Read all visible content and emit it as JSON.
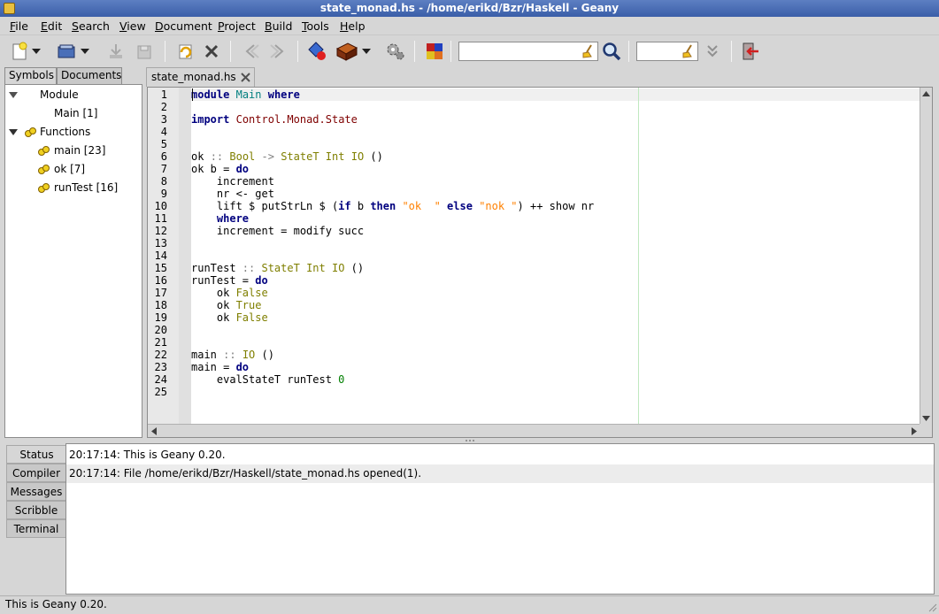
{
  "window": {
    "title": "state_monad.hs - /home/erikd/Bzr/Haskell - Geany"
  },
  "menu": [
    {
      "label": "File",
      "u": "F",
      "rest": "ile"
    },
    {
      "label": "Edit",
      "u": "E",
      "rest": "dit"
    },
    {
      "label": "Search",
      "u": "S",
      "rest": "earch"
    },
    {
      "label": "View",
      "u": "V",
      "rest": "iew"
    },
    {
      "label": "Document",
      "u": "D",
      "rest": "ocument"
    },
    {
      "label": "Project",
      "u": "P",
      "rest": "roject"
    },
    {
      "label": "Build",
      "u": "B",
      "rest": "uild"
    },
    {
      "label": "Tools",
      "u": "T",
      "rest": "ools"
    },
    {
      "label": "Help",
      "u": "H",
      "rest": "elp"
    }
  ],
  "toolbar": {
    "search_value": "",
    "goto_value": ""
  },
  "sidebar": {
    "tabs": [
      "Symbols",
      "Documents"
    ],
    "active_tab": "Symbols",
    "tree": {
      "module_group": "Module",
      "module_item": "Main [1]",
      "functions_group": "Functions",
      "functions": [
        "main [23]",
        "ok [7]",
        "runTest [16]"
      ]
    }
  },
  "editor": {
    "tab_label": "state_monad.hs",
    "line_numbers": [
      "1",
      "2",
      "3",
      "4",
      "5",
      "6",
      "7",
      "8",
      "9",
      "10",
      "11",
      "12",
      "13",
      "14",
      "15",
      "16",
      "17",
      "18",
      "19",
      "20",
      "21",
      "22",
      "23",
      "24",
      "25"
    ],
    "lines": [
      "module Main where",
      "",
      "import Control.Monad.State",
      "",
      "",
      "ok :: Bool -> StateT Int IO ()",
      "ok b = do",
      "    increment",
      "    nr <- get",
      "    lift $ putStrLn $ (if b then \"ok  \" else \"nok \") ++ show nr",
      "    where",
      "    increment = modify succ",
      "",
      "",
      "runTest :: StateT Int IO ()",
      "runTest = do",
      "    ok False",
      "    ok True",
      "    ok False",
      "",
      "",
      "main :: IO ()",
      "main = do",
      "    evalStateT runTest 0",
      ""
    ]
  },
  "messages": {
    "tabs": [
      "Status",
      "Compiler",
      "Messages",
      "Scribble",
      "Terminal"
    ],
    "active_tab": "Status",
    "lines": [
      "20:17:14: This is Geany 0.20.",
      "20:17:14: File /home/erikd/Bzr/Haskell/state_monad.hs opened(1)."
    ]
  },
  "statusbar": {
    "text": "This is Geany 0.20."
  },
  "colors": {
    "keyword": "#00007f",
    "type": "#7f7f00",
    "module": "#7f0000",
    "string": "#ff8000",
    "number": "#007f00",
    "operator": "#7f7f7f",
    "module_name": "#007f7f"
  },
  "icons": [
    "new-file-icon",
    "open-file-icon",
    "save-icon",
    "save-all-icon",
    "revert-icon",
    "close-icon",
    "navigate-back-icon",
    "navigate-forward-icon",
    "compile-icon",
    "build-icon",
    "execute-icon",
    "color-chooser-icon",
    "find-icon",
    "jump-to-line-icon",
    "quit-icon"
  ]
}
